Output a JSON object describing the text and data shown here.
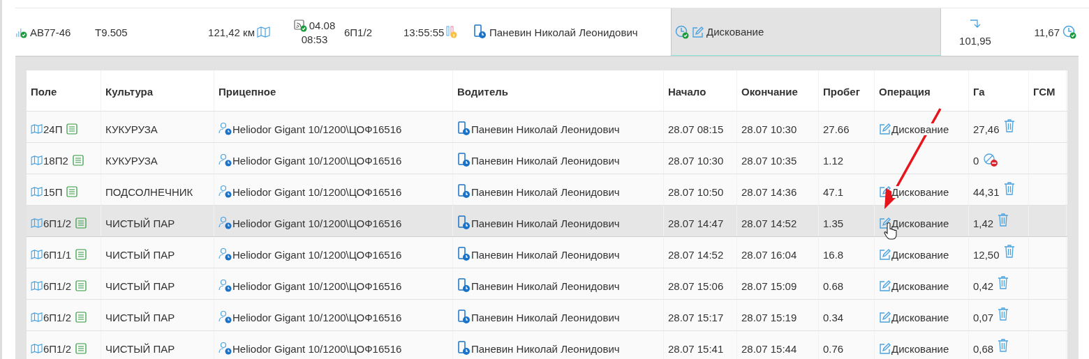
{
  "vehicle_row": {
    "vehicle": "АВ77-46",
    "code": "Т9.505",
    "distance": "121,42 км",
    "date": "04.08",
    "time": "08:53",
    "field": "6П1/2",
    "duration": "13:55:55",
    "driver": "Паневин Николай Леонидович",
    "operation": {
      "text": "Дискование",
      "selected": true
    },
    "mileage": "101,95",
    "area": "11,67"
  },
  "table": {
    "columns": [
      "Поле",
      "Культура",
      "Прицепное",
      "Водитель",
      "Начало",
      "Окончание",
      "Пробег",
      "Операция",
      "Га",
      "ГСМ"
    ],
    "rows": [
      {
        "field": "24П",
        "crop": "КУКУРУЗА",
        "trailer": "Heliodor Gigant 10/1200\\ЦОФ16516",
        "driver": "Паневин Николай Леонидович",
        "start": "28.07 08:15",
        "end": "28.07 10:30",
        "mileage": "27.66",
        "operation": "Дискование",
        "ha": "27,46",
        "kind": "delete",
        "highlighted": false
      },
      {
        "field": "18П2",
        "crop": "КУКУРУЗА",
        "trailer": "Heliodor Gigant 10/1200\\ЦОФ16516",
        "driver": "Паневин Николай Леонидович",
        "start": "28.07 10:30",
        "end": "28.07 10:35",
        "mileage": "1.12",
        "ha": "0",
        "kind": "blocked",
        "highlighted": false
      },
      {
        "field": "15П",
        "crop": "ПОДСОЛНЕЧНИК",
        "trailer": "Heliodor Gigant 10/1200\\ЦОФ16516",
        "driver": "Паневин Николай Леонидович",
        "start": "28.07 10:50",
        "end": "28.07 14:36",
        "mileage": "47.1",
        "operation": "Дискование",
        "ha": "44,31",
        "kind": "delete",
        "highlighted": false
      },
      {
        "field": "6П1/2",
        "crop": "ЧИСТЫЙ ПАР",
        "trailer": "Heliodor Gigant 10/1200\\ЦОФ16516",
        "driver": "Паневин Николай Леонидович",
        "start": "28.07 14:47",
        "end": "28.07 14:52",
        "mileage": "1.35",
        "operation": "Дискование",
        "ha": "1,42",
        "kind": "delete",
        "highlighted": true
      },
      {
        "field": "6П1/1",
        "crop": "ЧИСТЫЙ ПАР",
        "trailer": "Heliodor Gigant 10/1200\\ЦОФ16516",
        "driver": "Паневин Николай Леонидович",
        "start": "28.07 14:52",
        "end": "28.07 16:04",
        "mileage": "16.8",
        "operation": "Дискование",
        "ha": "12,50",
        "kind": "delete",
        "highlighted": false
      },
      {
        "field": "6П1/2",
        "crop": "ЧИСТЫЙ ПАР",
        "trailer": "Heliodor Gigant 10/1200\\ЦОФ16516",
        "driver": "Паневин Николай Леонидович",
        "start": "28.07 15:06",
        "end": "28.07 15:09",
        "mileage": "0.68",
        "operation": "Дискование",
        "ha": "0,42",
        "kind": "delete",
        "highlighted": false
      },
      {
        "field": "6П1/2",
        "crop": "ЧИСТЫЙ ПАР",
        "trailer": "Heliodor Gigant 10/1200\\ЦОФ16516",
        "driver": "Паневин Николай Леонидович",
        "start": "28.07 15:17",
        "end": "28.07 15:19",
        "mileage": "0.34",
        "operation": "Дискование",
        "ha": "0,07",
        "kind": "delete",
        "highlighted": false
      },
      {
        "field": "6П1/2",
        "crop": "ЧИСТЫЙ ПАР",
        "trailer": "Heliodor Gigant 10/1200\\ЦОФ16516",
        "driver": "Паневин Николай Леонидович",
        "start": "28.07 15:41",
        "end": "28.07 15:44",
        "mileage": "0.76",
        "operation": "Дискование",
        "ha": "0,68",
        "kind": "delete",
        "highlighted": false
      }
    ]
  }
}
